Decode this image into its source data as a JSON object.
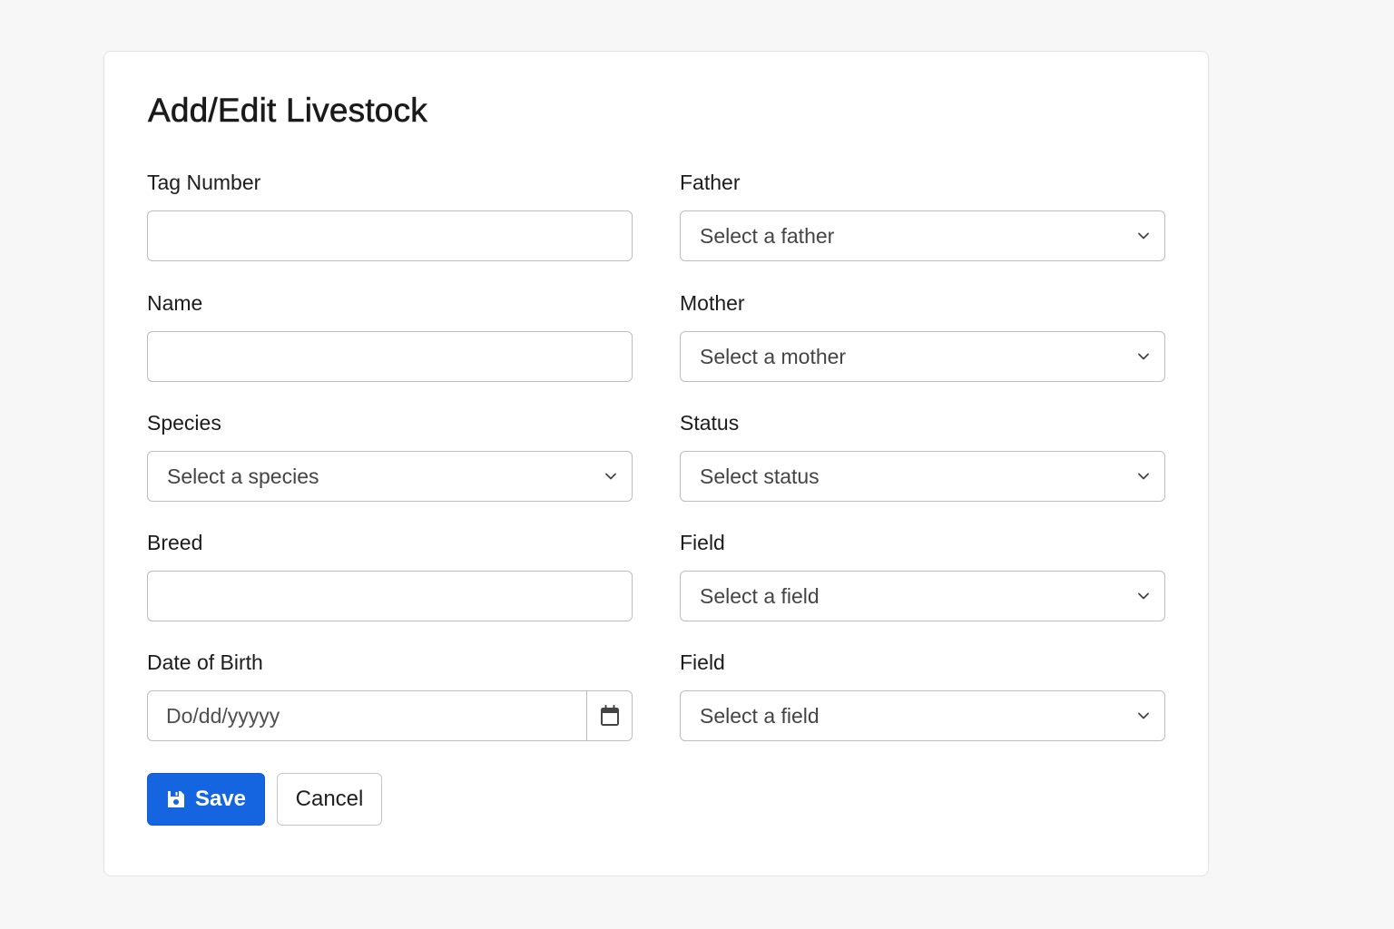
{
  "form": {
    "title": "Add/Edit Livestock",
    "tag_number": {
      "label": "Tag Number",
      "value": "",
      "placeholder": ""
    },
    "name": {
      "label": "Name",
      "value": "",
      "placeholder": ""
    },
    "species": {
      "label": "Species",
      "selected": "Select a species"
    },
    "breed": {
      "label": "Breed",
      "value": "",
      "placeholder": ""
    },
    "date_of_birth": {
      "label": "Date of Birth",
      "placeholder": "Do/dd/yyyyy",
      "icon": "calendar-icon"
    },
    "father": {
      "label": "Father",
      "selected": "Select a father"
    },
    "mother": {
      "label": "Mother",
      "selected": "Select a mother"
    },
    "status": {
      "label": "Status",
      "selected": "Select status"
    },
    "field_1": {
      "label": "Field",
      "selected": "Select a field"
    },
    "field_2": {
      "label": "Field",
      "selected": "Select a field"
    }
  },
  "actions": {
    "save_label": "Save",
    "save_icon": "floppy-disk-icon",
    "cancel_label": "Cancel"
  },
  "colors": {
    "primary": "#1565e0",
    "background": "#f7f7f7",
    "card": "#ffffff",
    "border": "#bdbdbd"
  }
}
